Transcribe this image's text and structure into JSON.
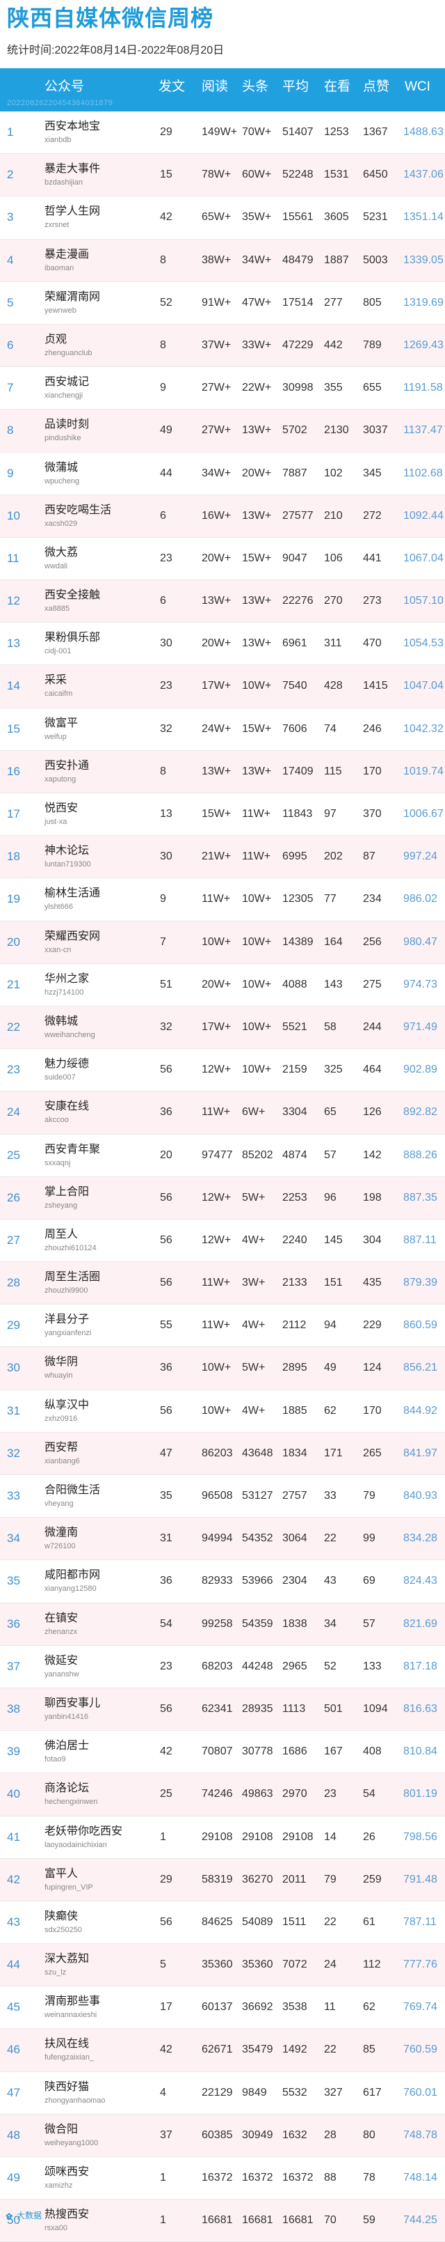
{
  "title": "陕西自媒体微信周榜",
  "period": "统计时间:2022年08月14日-2022年08月20日",
  "header_id": "2022082622045436403187​9",
  "columns": [
    "公众号",
    "发文",
    "阅读",
    "头条",
    "平均",
    "在看",
    "点赞",
    "WCI"
  ],
  "footer": "大数据",
  "rows": [
    [
      "1",
      "西安本地宝",
      "xianbdb",
      "29",
      "149W+",
      "70W+",
      "51407",
      "1253",
      "1367",
      "1488.63"
    ],
    [
      "2",
      "暴走大事件",
      "bzdashijian",
      "15",
      "78W+",
      "60W+",
      "52248",
      "1531",
      "6450",
      "1437.06"
    ],
    [
      "3",
      "哲学人生网",
      "zxrsnet",
      "42",
      "65W+",
      "35W+",
      "15561",
      "3605",
      "5231",
      "1351.14"
    ],
    [
      "4",
      "暴走漫画",
      "ibaoman",
      "8",
      "38W+",
      "34W+",
      "48479",
      "1887",
      "5003",
      "1339.05"
    ],
    [
      "5",
      "荣耀渭南网",
      "yewnweb",
      "52",
      "91W+",
      "47W+",
      "17514",
      "277",
      "805",
      "1319.69"
    ],
    [
      "6",
      "贞观",
      "zhenguanclub",
      "8",
      "37W+",
      "33W+",
      "47229",
      "442",
      "789",
      "1269.43"
    ],
    [
      "7",
      "西安城记",
      "xianchengji",
      "9",
      "27W+",
      "22W+",
      "30998",
      "355",
      "655",
      "1191.58"
    ],
    [
      "8",
      "品读时刻",
      "pindushike",
      "49",
      "27W+",
      "13W+",
      "5702",
      "2130",
      "3037",
      "1137.47"
    ],
    [
      "9",
      "微蒲城",
      "wpucheng",
      "44",
      "34W+",
      "20W+",
      "7887",
      "102",
      "345",
      "1102.68"
    ],
    [
      "10",
      "西安吃喝生活",
      "xacsh029",
      "6",
      "16W+",
      "13W+",
      "27577",
      "210",
      "272",
      "1092.44"
    ],
    [
      "11",
      "微大荔",
      "wwdali",
      "23",
      "20W+",
      "15W+",
      "9047",
      "106",
      "441",
      "1067.04"
    ],
    [
      "12",
      "西安全接触",
      "xa8885",
      "6",
      "13W+",
      "13W+",
      "22276",
      "270",
      "273",
      "1057.10"
    ],
    [
      "13",
      "果粉俱乐部",
      "cidj-001",
      "30",
      "20W+",
      "13W+",
      "6961",
      "311",
      "470",
      "1054.53"
    ],
    [
      "14",
      "采采",
      "caicaifm",
      "23",
      "17W+",
      "10W+",
      "7540",
      "428",
      "1415",
      "1047.04"
    ],
    [
      "15",
      "微富平",
      "weifup",
      "32",
      "24W+",
      "15W+",
      "7606",
      "74",
      "246",
      "1042.32"
    ],
    [
      "16",
      "西安扑通",
      "xaputong",
      "8",
      "13W+",
      "13W+",
      "17409",
      "115",
      "170",
      "1019.74"
    ],
    [
      "17",
      "悦西安",
      "just-xa",
      "13",
      "15W+",
      "11W+",
      "11843",
      "97",
      "370",
      "1006.67"
    ],
    [
      "18",
      "神木论坛",
      "luntan719300",
      "30",
      "21W+",
      "11W+",
      "6995",
      "202",
      "87",
      "997.24"
    ],
    [
      "19",
      "榆林生活通",
      "ylsht666",
      "9",
      "11W+",
      "10W+",
      "12305",
      "77",
      "234",
      "986.02"
    ],
    [
      "20",
      "荣耀西安网",
      "xxan-cn",
      "7",
      "10W+",
      "10W+",
      "14389",
      "164",
      "256",
      "980.47"
    ],
    [
      "21",
      "华州之家",
      "hzzj714100",
      "51",
      "20W+",
      "10W+",
      "4088",
      "143",
      "275",
      "974.73"
    ],
    [
      "22",
      "微韩城",
      "wweihancheng",
      "32",
      "17W+",
      "10W+",
      "5521",
      "58",
      "244",
      "971.49"
    ],
    [
      "23",
      "魅力绥德",
      "suide007",
      "56",
      "12W+",
      "10W+",
      "2159",
      "325",
      "464",
      "902.89"
    ],
    [
      "24",
      "安康在线",
      "akccoo",
      "36",
      "11W+",
      "6W+",
      "3304",
      "65",
      "126",
      "892.82"
    ],
    [
      "25",
      "西安青年聚",
      "sxxaqnj",
      "20",
      "97477",
      "85202",
      "4874",
      "57",
      "142",
      "888.26"
    ],
    [
      "26",
      "掌上合阳",
      "zsheyang",
      "56",
      "12W+",
      "5W+",
      "2253",
      "96",
      "198",
      "887.35"
    ],
    [
      "27",
      "周至人",
      "zhouzhi610124",
      "56",
      "12W+",
      "4W+",
      "2240",
      "145",
      "304",
      "887.11"
    ],
    [
      "28",
      "周至生活圈",
      "zhouzhi9900",
      "56",
      "11W+",
      "3W+",
      "2133",
      "151",
      "435",
      "879.39"
    ],
    [
      "29",
      "洋县分子",
      "yangxianfenzi",
      "55",
      "11W+",
      "4W+",
      "2112",
      "94",
      "229",
      "860.59"
    ],
    [
      "30",
      "微华阴",
      "whuayin",
      "36",
      "10W+",
      "5W+",
      "2895",
      "49",
      "124",
      "856.21"
    ],
    [
      "31",
      "纵享汉中",
      "zxhz0916",
      "56",
      "10W+",
      "4W+",
      "1885",
      "62",
      "170",
      "844.92"
    ],
    [
      "32",
      "西安帮",
      "xianbang6",
      "47",
      "86203",
      "43648",
      "1834",
      "171",
      "265",
      "841.97"
    ],
    [
      "33",
      "合阳微生活",
      "vheyang",
      "35",
      "96508",
      "53127",
      "2757",
      "33",
      "79",
      "840.93"
    ],
    [
      "34",
      "微潼南",
      "w726100",
      "31",
      "94994",
      "54352",
      "3064",
      "22",
      "99",
      "834.28"
    ],
    [
      "35",
      "咸阳都市网",
      "xianyang12580",
      "36",
      "82933",
      "53966",
      "2304",
      "43",
      "69",
      "824.43"
    ],
    [
      "36",
      "在镇安",
      "zhenanzx",
      "54",
      "99258",
      "54359",
      "1838",
      "34",
      "57",
      "821.69"
    ],
    [
      "37",
      "微延安",
      "yananshw",
      "23",
      "68203",
      "44248",
      "2965",
      "52",
      "133",
      "817.18"
    ],
    [
      "38",
      "聊西安事儿",
      "yanbin41416",
      "56",
      "62341",
      "28935",
      "1113",
      "501",
      "1094",
      "816.63"
    ],
    [
      "39",
      "佛泊居士",
      "fotao9",
      "42",
      "70807",
      "30778",
      "1686",
      "167",
      "408",
      "810.84"
    ],
    [
      "40",
      "商洛论坛",
      "hechengxinwen",
      "25",
      "74246",
      "49863",
      "2970",
      "23",
      "54",
      "801.19"
    ],
    [
      "41",
      "老妖带你吃西安",
      "laoyaodainichixian",
      "1",
      "29108",
      "29108",
      "29108",
      "14",
      "26",
      "798.56"
    ],
    [
      "42",
      "富平人",
      "fupingren_VIP",
      "29",
      "58319",
      "36270",
      "2011",
      "79",
      "259",
      "791.48"
    ],
    [
      "43",
      "陕癫侠",
      "sdx250250",
      "56",
      "84625",
      "54089",
      "1511",
      "22",
      "61",
      "787.11"
    ],
    [
      "44",
      "深大荔知",
      "szu_lz",
      "5",
      "35360",
      "35360",
      "7072",
      "24",
      "112",
      "777.76"
    ],
    [
      "45",
      "渭南那些事",
      "weinannaxieshi",
      "17",
      "60137",
      "36692",
      "3538",
      "11",
      "62",
      "769.74"
    ],
    [
      "46",
      "扶风在线",
      "fufengzaixian_",
      "42",
      "62671",
      "35479",
      "1492",
      "22",
      "85",
      "760.59"
    ],
    [
      "47",
      "陕西好猫",
      "zhongyanhaomao",
      "4",
      "22129",
      "9849",
      "5532",
      "327",
      "617",
      "760.01"
    ],
    [
      "48",
      "微合阳",
      "weiheyang1000",
      "37",
      "60385",
      "30949",
      "1632",
      "28",
      "80",
      "748.78"
    ],
    [
      "49",
      "颂咪西安",
      "xamizhz",
      "1",
      "16372",
      "16372",
      "16372",
      "88",
      "78",
      "748.14"
    ],
    [
      "50",
      "热搜西安",
      "rsxa00",
      "1",
      "16681",
      "16681",
      "16681",
      "70",
      "59",
      "744.25"
    ]
  ]
}
